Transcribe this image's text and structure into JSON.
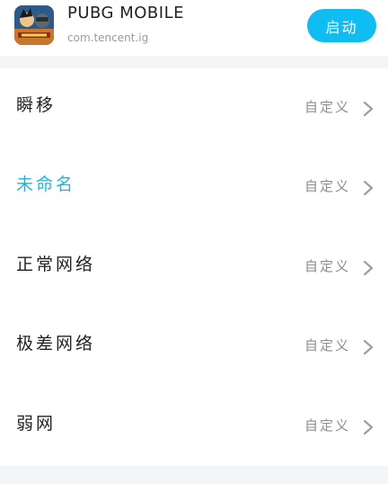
{
  "app": {
    "name": "PUBG MOBILE",
    "package": "com.tencent.ig",
    "launch_label": "启动"
  },
  "items": [
    {
      "label": "瞬移",
      "value": "自定义",
      "active": false
    },
    {
      "label": "未命名",
      "value": "自定义",
      "active": true
    },
    {
      "label": "正常网络",
      "value": "自定义",
      "active": false
    },
    {
      "label": "极差网络",
      "value": "自定义",
      "active": false
    },
    {
      "label": "弱网",
      "value": "自定义",
      "active": false
    }
  ],
  "colors": {
    "accent": "#18b6e0",
    "button": "#0fbdf2",
    "separator": "#f4f5f7"
  }
}
